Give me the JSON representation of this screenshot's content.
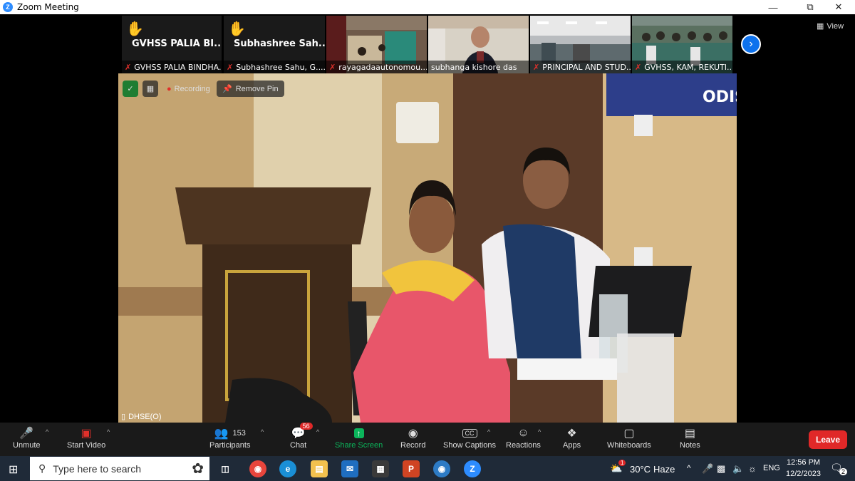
{
  "window": {
    "title": "Zoom Meeting",
    "app_icon": "zoom-icon"
  },
  "thumbnails": [
    {
      "big_name": "GVHSS PALIA BI...",
      "caption": "GVHSS PALIA BINDHA...",
      "hand_raised": true
    },
    {
      "big_name": "Subhashree  Sah...",
      "caption": "Subhashree Sahu, G....",
      "hand_raised": true
    },
    {
      "big_name": "",
      "caption": "rayagadaautonomou...",
      "hand_raised": false
    },
    {
      "big_name": "",
      "caption": "subhanga kishore das",
      "hand_raised": false
    },
    {
      "big_name": "",
      "caption": "PRINCIPAL AND STUD...",
      "hand_raised": false
    },
    {
      "big_name": "",
      "caption": "GVHSS, KAM, REKUTI...",
      "hand_raised": false
    }
  ],
  "view_label": "View",
  "main_video": {
    "recording_label": "Recording",
    "remove_pin_label": "Remove Pin",
    "speaker_name": "DHSE(O)",
    "banner_text": "ODISHA ,"
  },
  "toolbar": {
    "unmute": "Unmute",
    "start_video": "Start Video",
    "participants_label": "Participants",
    "participants_count": "153",
    "chat_label": "Chat",
    "chat_badge": "56",
    "share_screen": "Share Screen",
    "record": "Record",
    "show_captions": "Show Captions",
    "captions_icon_text": "CC",
    "reactions": "Reactions",
    "apps": "Apps",
    "whiteboards": "Whiteboards",
    "notes": "Notes",
    "leave": "Leave"
  },
  "taskbar": {
    "search_placeholder": "Type here to search",
    "weather_badge": "1",
    "weather_temp": "30°C",
    "weather_desc": "Haze",
    "lang": "ENG",
    "time": "12:56 PM",
    "date": "12/2/2023",
    "notification_count": "2",
    "zoom_app_letter": "Z"
  },
  "colors": {
    "zoom_blue": "#2d8cff",
    "leave_red": "#e02828",
    "share_green": "#0bb55b",
    "taskbar": "#1f2a38"
  }
}
